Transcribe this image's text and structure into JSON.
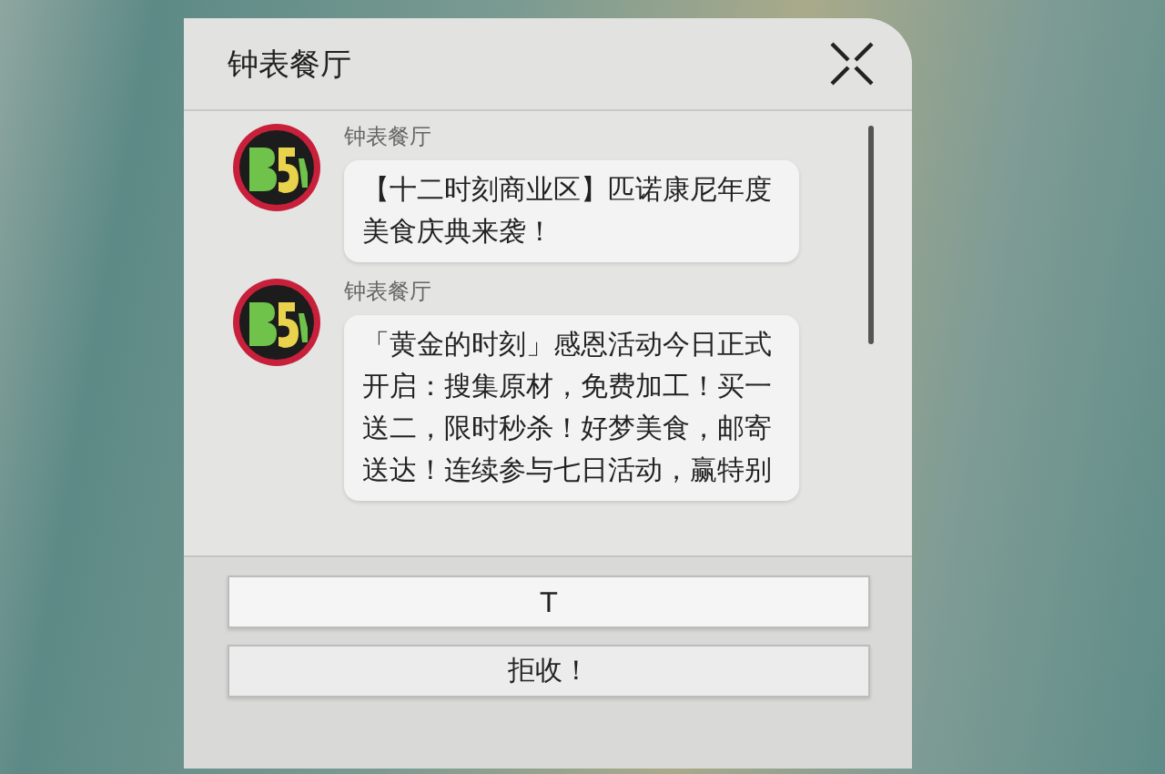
{
  "dialog": {
    "title": "钟表餐厅"
  },
  "messages": [
    {
      "sender": "钟表餐厅",
      "text": "【十二时刻商业区】匹诺康尼年度美食庆典来袭！"
    },
    {
      "sender": "钟表餐厅",
      "text": "「黄金的时刻」感恩活动今日正式开启：搜集原材，免费加工！买一送二，限时秒杀！好梦美食，邮寄送达！连续参与七日活动，赢特别"
    }
  ],
  "buttons": [
    "T",
    "拒收！"
  ]
}
